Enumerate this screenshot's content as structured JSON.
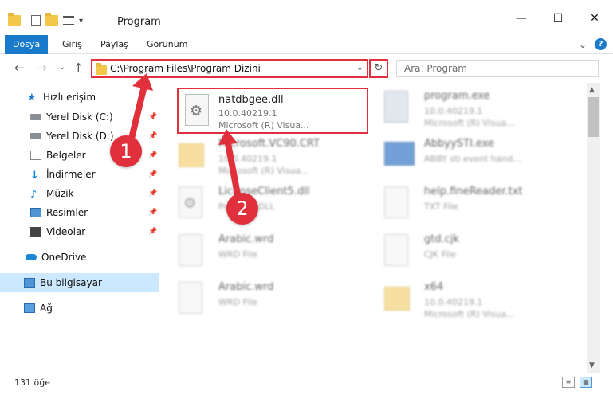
{
  "window": {
    "title": "Program",
    "qat_dropdown": "▾",
    "minimize": "—",
    "maximize": "☐",
    "close": "✕"
  },
  "ribbon": {
    "tabs": [
      "Dosya",
      "Giriş",
      "Paylaş",
      "Görünüm"
    ],
    "expand": "⌄",
    "help": "?"
  },
  "address": {
    "back": "←",
    "forward": "→",
    "recent": "⌄",
    "up": "↑",
    "path": "C:\\Program Files\\Program Dizini",
    "dropdown": "⌄",
    "refresh": "↻",
    "search_placeholder": "Ara: Program"
  },
  "sidebar": {
    "quick_access": "Hızlı erişim",
    "items": [
      {
        "label": "Yerel Disk (C:)",
        "icon": "drive-icon"
      },
      {
        "label": "Yerel Disk (D:)",
        "icon": "drive-icon"
      },
      {
        "label": "Belgeler",
        "icon": "documents-icon"
      },
      {
        "label": "İndirmeler",
        "icon": "downloads-icon"
      },
      {
        "label": "Müzik",
        "icon": "music-icon"
      },
      {
        "label": "Resimler",
        "icon": "pictures-icon"
      },
      {
        "label": "Videolar",
        "icon": "videos-icon"
      }
    ],
    "onedrive": "OneDrive",
    "this_pc": "Bu bilgisayar",
    "network": "Ağ",
    "pin": "📌"
  },
  "files": [
    {
      "name": "natdbgee.dll",
      "line1": "10.0.40219.1",
      "line2": "Microsoft (R) Visua..."
    },
    {
      "name": "program.exe",
      "line1": "10.0.40219.1",
      "line2": "Microsoft (R) Visua..."
    },
    {
      "name": "Microsoft.VC90.CRT",
      "line1": "10.0.40219.1",
      "line2": "Microsoft (R) Visua..."
    },
    {
      "name": "AbbyySTI.exe",
      "line1": "ABBY sti event hand...",
      "line2": ""
    },
    {
      "name": "LicenseClient5.dll",
      "line1": "Program DLL",
      "line2": ""
    },
    {
      "name": "help.fineReader.txt",
      "line1": "TXT File",
      "line2": ""
    },
    {
      "name": "Arabic.wrd",
      "line1": "WRD File",
      "line2": ""
    },
    {
      "name": "gtd.cjk",
      "line1": "CJK File",
      "line2": ""
    },
    {
      "name": "Arabic.wrd",
      "line1": "WRD File",
      "line2": ""
    },
    {
      "name": "x64",
      "line1": "10.0.40219.1",
      "line2": "Microsoft (R) Visua..."
    }
  ],
  "status": {
    "count": "131 öğe"
  },
  "callouts": {
    "one": "1",
    "two": "2"
  },
  "colors": {
    "accent": "#1979ca",
    "highlight_red": "#e0303c",
    "selected_nav": "#cce8ff"
  }
}
